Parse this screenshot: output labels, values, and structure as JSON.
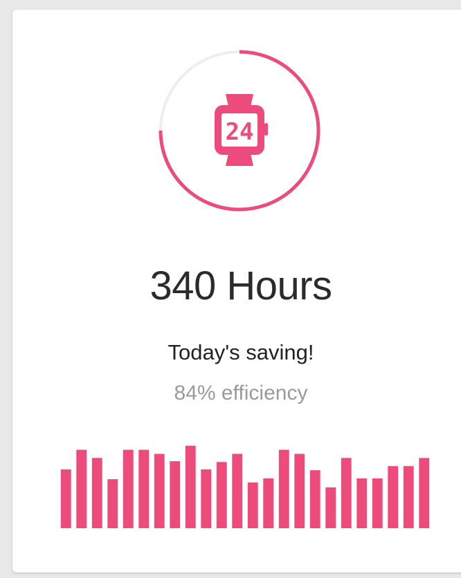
{
  "accent_color": "#ec4b7c",
  "track_color": "#eeeeee",
  "ring": {
    "progress": 0.75
  },
  "icon": {
    "name": "smartwatch-icon",
    "display": "24"
  },
  "stat": {
    "value_label": "340 Hours",
    "caption": "Today's saving!",
    "efficiency": "84% efficiency"
  },
  "chart_data": {
    "type": "bar",
    "values": [
      72,
      96,
      86,
      60,
      96,
      96,
      91,
      82,
      101,
      72,
      81,
      91,
      56,
      61,
      96,
      91,
      71,
      50,
      86,
      61,
      61,
      76,
      76,
      86
    ],
    "ylim": [
      0,
      110
    ]
  }
}
